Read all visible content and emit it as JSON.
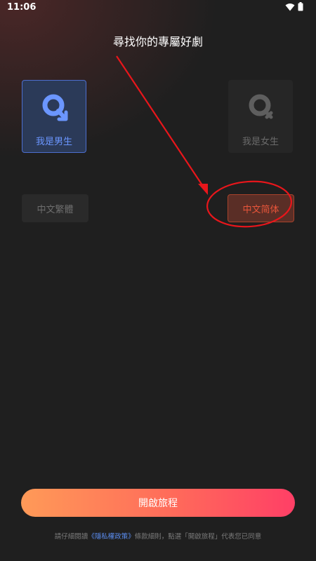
{
  "status_bar": {
    "time": "11:06",
    "wifi_icon": "wifi-icon",
    "battery_icon": "battery-icon"
  },
  "title": "尋找你的專屬好劇",
  "gender": {
    "male": {
      "label": "我是男生",
      "icon": "male-gender-icon",
      "selected": true,
      "color": "#6b96ff"
    },
    "female": {
      "label": "我是女生",
      "icon": "female-gender-icon",
      "selected": false,
      "color": "#6a6a6a"
    }
  },
  "language": {
    "traditional": {
      "label": "中文繁體",
      "selected": false
    },
    "simplified": {
      "label": "中文简体",
      "selected": true,
      "color": "#e8553a"
    }
  },
  "start_button": {
    "label": "開啟旅程"
  },
  "terms": {
    "prefix": "請仔細閱讀",
    "link": "《隱私權政策》",
    "suffix": "條款細則，點選「開啟旅程」代表您已同意"
  },
  "colors": {
    "background": "#1f1f1f",
    "annotation_red": "#e8161b",
    "button_gradient_start": "#ff9a58",
    "button_gradient_end": "#ff3f66"
  }
}
